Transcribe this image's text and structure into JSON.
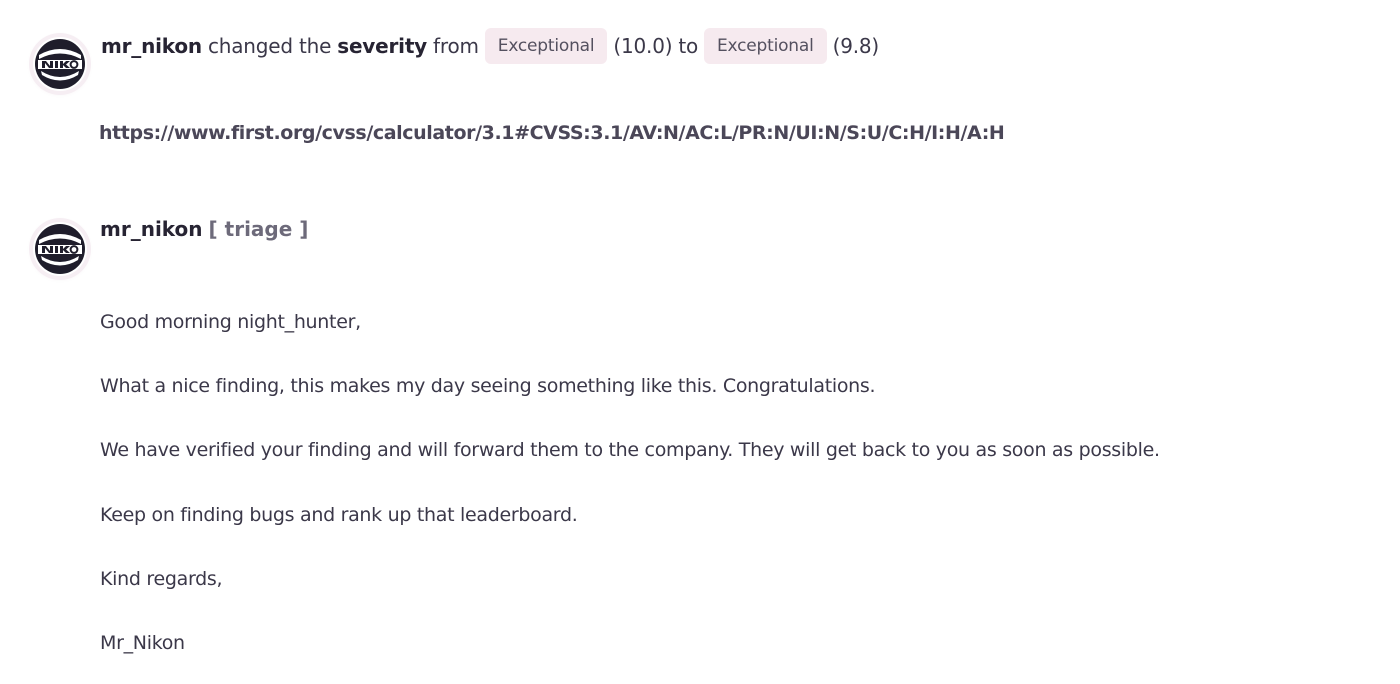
{
  "activity_change": {
    "user": "mr_nikon",
    "text_changed": "changed the",
    "field": "severity",
    "text_from": "from",
    "old_severity": "Exceptional",
    "old_score": "(10.0)",
    "text_to": "to",
    "new_severity": "Exceptional",
    "new_score": "(9.8)",
    "link": "https://www.first.org/cvss/calculator/3.1#CVSS:3.1/AV:N/AC:L/PR:N/UI:N/S:U/C:H/I:H/A:H"
  },
  "comment": {
    "user": "mr_nikon",
    "role": "[ triage ]",
    "paragraphs": [
      "Good morning night_hunter,",
      "What a nice finding, this makes my day seeing something like this. Congratulations.",
      "We have verified your finding and will forward them to the company. They will get back to you as soon as possible.",
      "Keep on finding bugs and rank up that leaderboard.",
      "Kind regards,",
      "Mr_Nikon"
    ]
  },
  "colors": {
    "pill_background": "#f6eaef",
    "text": "#3b3849",
    "username": "#272433",
    "role": "#6d6a7a"
  },
  "icons": {
    "avatar": "nikon-logo-avatar-icon"
  }
}
